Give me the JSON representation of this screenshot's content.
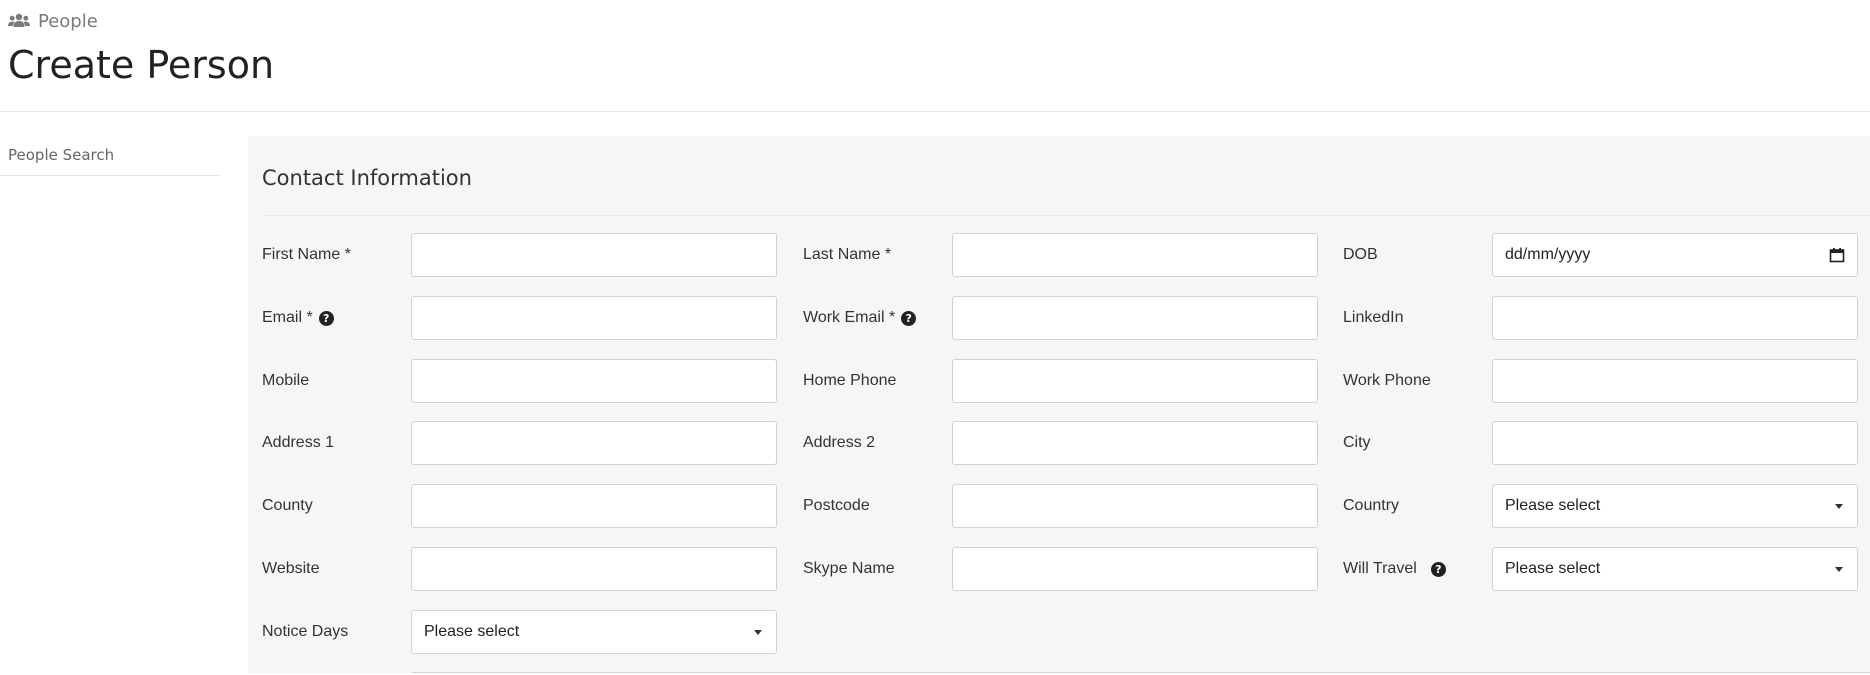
{
  "breadcrumb": {
    "icon": "people-group-icon",
    "label": "People"
  },
  "page_title": "Create Person",
  "sidebar": {
    "items": [
      {
        "label": "People Search"
      }
    ]
  },
  "section": {
    "title": "Contact Information"
  },
  "fields": {
    "first_name": {
      "label": "First Name *",
      "value": ""
    },
    "last_name": {
      "label": "Last Name *",
      "value": ""
    },
    "dob": {
      "label": "DOB",
      "placeholder": "dd/mm/yyyy"
    },
    "email": {
      "label": "Email *",
      "help": "?",
      "value": ""
    },
    "work_email": {
      "label": "Work Email *",
      "help": "?",
      "value": ""
    },
    "linkedin": {
      "label": "LinkedIn",
      "value": ""
    },
    "mobile": {
      "label": "Mobile",
      "value": ""
    },
    "home_phone": {
      "label": "Home Phone",
      "value": ""
    },
    "work_phone": {
      "label": "Work Phone",
      "value": ""
    },
    "address1": {
      "label": "Address 1",
      "value": ""
    },
    "address2": {
      "label": "Address 2",
      "value": ""
    },
    "city": {
      "label": "City",
      "value": ""
    },
    "county": {
      "label": "County",
      "value": ""
    },
    "postcode": {
      "label": "Postcode",
      "value": ""
    },
    "country": {
      "label": "Country",
      "selected": "Please select"
    },
    "website": {
      "label": "Website",
      "value": ""
    },
    "skype": {
      "label": "Skype Name",
      "value": ""
    },
    "will_travel": {
      "label": "Will Travel",
      "help": "?",
      "selected": "Please select"
    },
    "notice_days": {
      "label": "Notice Days",
      "selected": "Please select"
    }
  },
  "colors": {
    "panel_bg": "#f5f7f6",
    "text": "#333333",
    "muted": "#7a7a7a",
    "border": "#cfd3d2"
  }
}
